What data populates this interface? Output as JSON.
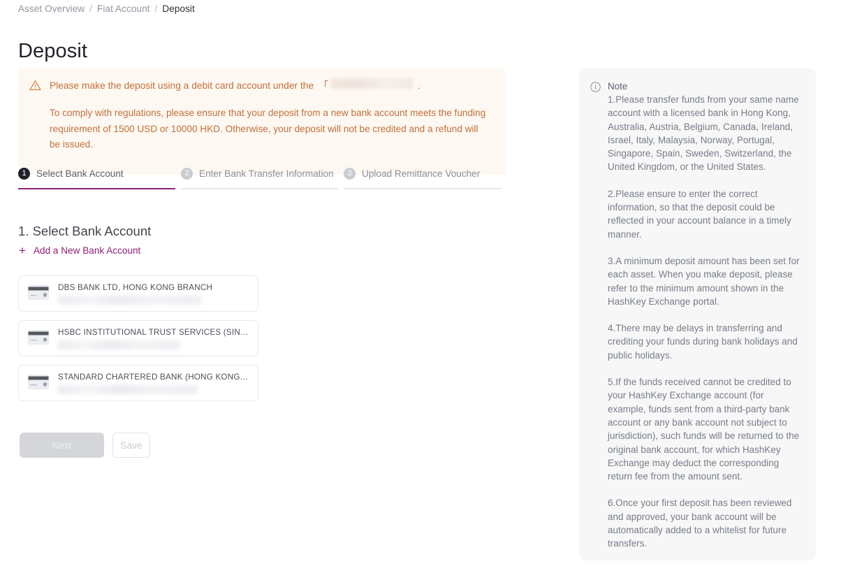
{
  "breadcrumb": {
    "items": [
      {
        "label": "Asset Overview",
        "current": false
      },
      {
        "label": "Fiat Account",
        "current": false
      },
      {
        "label": "Deposit",
        "current": true
      }
    ],
    "separator": "/"
  },
  "page": {
    "title": "Deposit"
  },
  "warning": {
    "icon": "warning-triangle-icon",
    "line1_before": "Please make the deposit using a debit card account under the",
    "bracket": "「",
    "redacted_value": "",
    "line1_after": ".",
    "paragraph": "To comply with regulations, please ensure that your deposit from a new bank account meets the funding requirement of 1500 USD or 10000 HKD. Otherwise, your deposit will not be credited and a refund will be issued.",
    "accent_color": "#c2703a",
    "background_color": "#fdf8f2"
  },
  "stepper": {
    "active_index": 0,
    "active_color": "#8d2077",
    "steps": [
      {
        "number": "1",
        "label": "Select Bank Account"
      },
      {
        "number": "2",
        "label": "Enter Bank Transfer Information"
      },
      {
        "number": "3",
        "label": "Upload Remittance Voucher"
      }
    ]
  },
  "section": {
    "title": "1. Select Bank Account",
    "add_account_label": "Add a New Bank Account",
    "add_account_icon": "plus-icon",
    "accent_color": "#8d2077"
  },
  "bank_accounts": [
    {
      "name": "DBS BANK LTD, HONG KONG BRANCH",
      "account_number": "",
      "icon": "credit-card-icon"
    },
    {
      "name": "HSBC INSTITUTIONAL TRUST SERVICES (SIN…",
      "account_number": "",
      "icon": "credit-card-icon"
    },
    {
      "name": "STANDARD CHARTERED BANK (HONG KONG)…",
      "account_number": "",
      "icon": "credit-card-icon"
    }
  ],
  "actions": {
    "next_label": "Next",
    "save_label": "Save",
    "next_disabled": true,
    "save_disabled": true
  },
  "note": {
    "icon": "info-circle-icon",
    "title": "Note",
    "paragraphs": [
      "1.Please transfer funds from your same name account with a licensed bank in Hong Kong, Australia, Austria, Belgium, Canada, Ireland, Israel, Italy, Malaysia, Norway, Portugal, Singapore, Spain, Sweden, Switzerland, the United Kingdom, or the United States.",
      "2.Please ensure to enter the correct information, so that the deposit could be reflected in your account balance in a timely manner.",
      "3.A minimum deposit amount has been set for each asset. When you make deposit, please refer to the minimum amount shown in the HashKey Exchange portal.",
      "4.There may be delays in transferring and crediting your funds during bank holidays and public holidays.",
      "5.If the funds received cannot be credited to your HashKey Exchange account (for example, funds sent from a third-party bank account or any bank account not subject to jurisdiction), such funds will be returned to the original bank account, for which HashKey Exchange may deduct the corresponding return fee from the amount sent.",
      "6.Once your first deposit has been reviewed and approved, your bank account will be automatically added to a whitelist for future transfers."
    ]
  }
}
